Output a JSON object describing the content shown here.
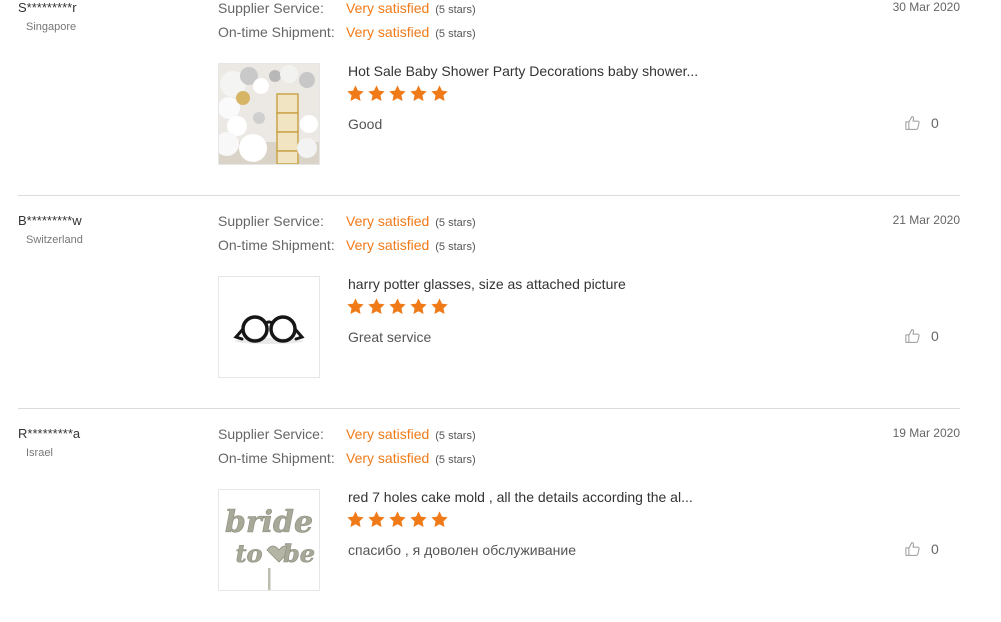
{
  "labels": {
    "supplier_service": "Supplier Service:",
    "ontime_shipment": "On-time Shipment:"
  },
  "colors": {
    "accent": "#f07a18",
    "divider": "#dcdcdc"
  },
  "reviews": [
    {
      "buyer": "S*********r",
      "country": "Singapore",
      "supplier_value": "Very satisfied",
      "supplier_stars": "(5 stars)",
      "shipment_value": "Very satisfied",
      "shipment_stars": "(5 stars)",
      "date": "30 Mar 2020",
      "product_title": "Hot Sale Baby Shower Party Decorations baby shower...",
      "product_image": "balloons-and-baby-blocks",
      "rating": 5,
      "comment": "Good",
      "helpful_count": "0"
    },
    {
      "buyer": "B*********w",
      "country": "Switzerland",
      "supplier_value": "Very satisfied",
      "supplier_stars": "(5 stars)",
      "shipment_value": "Very satisfied",
      "shipment_stars": "(5 stars)",
      "date": "21 Mar 2020",
      "product_title": "harry potter glasses, size as attached picture",
      "product_image": "round-glasses",
      "rating": 5,
      "comment": "Great service",
      "helpful_count": "0"
    },
    {
      "buyer": "R*********a",
      "country": "Israel",
      "supplier_value": "Very satisfied",
      "supplier_stars": "(5 stars)",
      "shipment_value": "Very satisfied",
      "shipment_stars": "(5 stars)",
      "date": "19 Mar 2020",
      "product_title": "red 7 holes cake mold , all the details according the al...",
      "product_image": "bride-to-be-cake-topper",
      "rating": 5,
      "comment": "спасибо , я доволен обслуживание",
      "helpful_count": "0",
      "image_text": "bride to be"
    }
  ]
}
